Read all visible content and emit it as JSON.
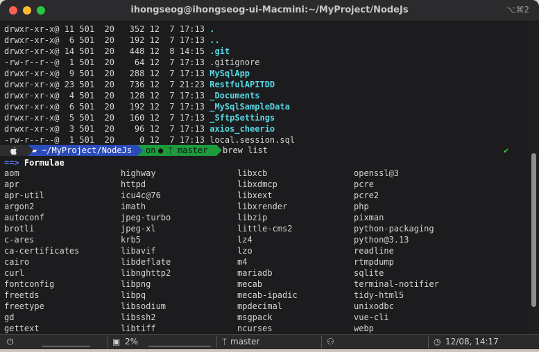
{
  "window": {
    "title": "ihongseog@ihongseog-ui-Macmini:~/MyProject/NodeJs",
    "shortcut": "⌥⌘2"
  },
  "listing": [
    {
      "perm": "drwxr-xr-x@",
      "links": "11",
      "uid": "501",
      "gid": "20",
      "size": "352",
      "month": "12",
      "day": "7",
      "time": "17:13",
      "name": ".",
      "is_dir": true
    },
    {
      "perm": "drwxr-xr-x@",
      "links": "6",
      "uid": "501",
      "gid": "20",
      "size": "192",
      "month": "12",
      "day": "7",
      "time": "17:13",
      "name": "..",
      "is_dir": true
    },
    {
      "perm": "drwxr-xr-x@",
      "links": "14",
      "uid": "501",
      "gid": "20",
      "size": "448",
      "month": "12",
      "day": "8",
      "time": "14:15",
      "name": ".git",
      "is_dir": true
    },
    {
      "perm": "-rw-r--r--@",
      "links": "1",
      "uid": "501",
      "gid": "20",
      "size": "64",
      "month": "12",
      "day": "7",
      "time": "17:13",
      "name": ".gitignore",
      "is_dir": false
    },
    {
      "perm": "drwxr-xr-x@",
      "links": "9",
      "uid": "501",
      "gid": "20",
      "size": "288",
      "month": "12",
      "day": "7",
      "time": "17:13",
      "name": "MySqlApp",
      "is_dir": true
    },
    {
      "perm": "drwxr-xr-x@",
      "links": "23",
      "uid": "501",
      "gid": "20",
      "size": "736",
      "month": "12",
      "day": "7",
      "time": "21:23",
      "name": "RestfulAPITDD",
      "is_dir": true
    },
    {
      "perm": "drwxr-xr-x@",
      "links": "4",
      "uid": "501",
      "gid": "20",
      "size": "128",
      "month": "12",
      "day": "7",
      "time": "17:13",
      "name": "_Documents",
      "is_dir": true
    },
    {
      "perm": "drwxr-xr-x@",
      "links": "6",
      "uid": "501",
      "gid": "20",
      "size": "192",
      "month": "12",
      "day": "7",
      "time": "17:13",
      "name": "_MySqlSampleData",
      "is_dir": true
    },
    {
      "perm": "drwxr-xr-x@",
      "links": "5",
      "uid": "501",
      "gid": "20",
      "size": "160",
      "month": "12",
      "day": "7",
      "time": "17:13",
      "name": "_SftpSettings",
      "is_dir": true
    },
    {
      "perm": "drwxr-xr-x@",
      "links": "3",
      "uid": "501",
      "gid": "20",
      "size": "96",
      "month": "12",
      "day": "7",
      "time": "17:13",
      "name": "axios_cheerio",
      "is_dir": true
    },
    {
      "perm": "-rw-r--r--@",
      "links": "1",
      "uid": "501",
      "gid": "20",
      "size": "0",
      "month": "12",
      "day": "7",
      "time": "17:13",
      "name": "local.session.sql",
      "is_dir": false
    }
  ],
  "prompt": {
    "path": "~/MyProject/NodeJs",
    "on": "on",
    "branch": "master",
    "command": "brew list",
    "check": "✔"
  },
  "formulae_heading": "Formulae",
  "formulae_columns": [
    [
      "aom",
      "apr",
      "apr-util",
      "argon2",
      "autoconf",
      "brotli",
      "c-ares",
      "ca-certificates",
      "cairo",
      "curl",
      "fontconfig",
      "freetds",
      "freetype",
      "gd",
      "gettext"
    ],
    [
      "highway",
      "httpd",
      "icu4c@76",
      "imath",
      "jpeg-turbo",
      "jpeg-xl",
      "krb5",
      "libavif",
      "libdeflate",
      "libnghttp2",
      "libpng",
      "libpq",
      "libsodium",
      "libssh2",
      "libtiff"
    ],
    [
      "libxcb",
      "libxdmcp",
      "libxext",
      "libxrender",
      "libzip",
      "little-cms2",
      "lz4",
      "lzo",
      "m4",
      "mariadb",
      "mecab",
      "mecab-ipadic",
      "mpdecimal",
      "msgpack",
      "ncurses"
    ],
    [
      "openssl@3",
      "pcre",
      "pcre2",
      "php",
      "pixman",
      "python-packaging",
      "python@3.13",
      "readline",
      "rtmpdump",
      "sqlite",
      "terminal-notifier",
      "tidy-html5",
      "unixodbc",
      "vue-cli",
      "webp"
    ]
  ],
  "statusbar": {
    "cpu": "2%",
    "branch": "master",
    "datetime": "12/08, 14:17"
  }
}
